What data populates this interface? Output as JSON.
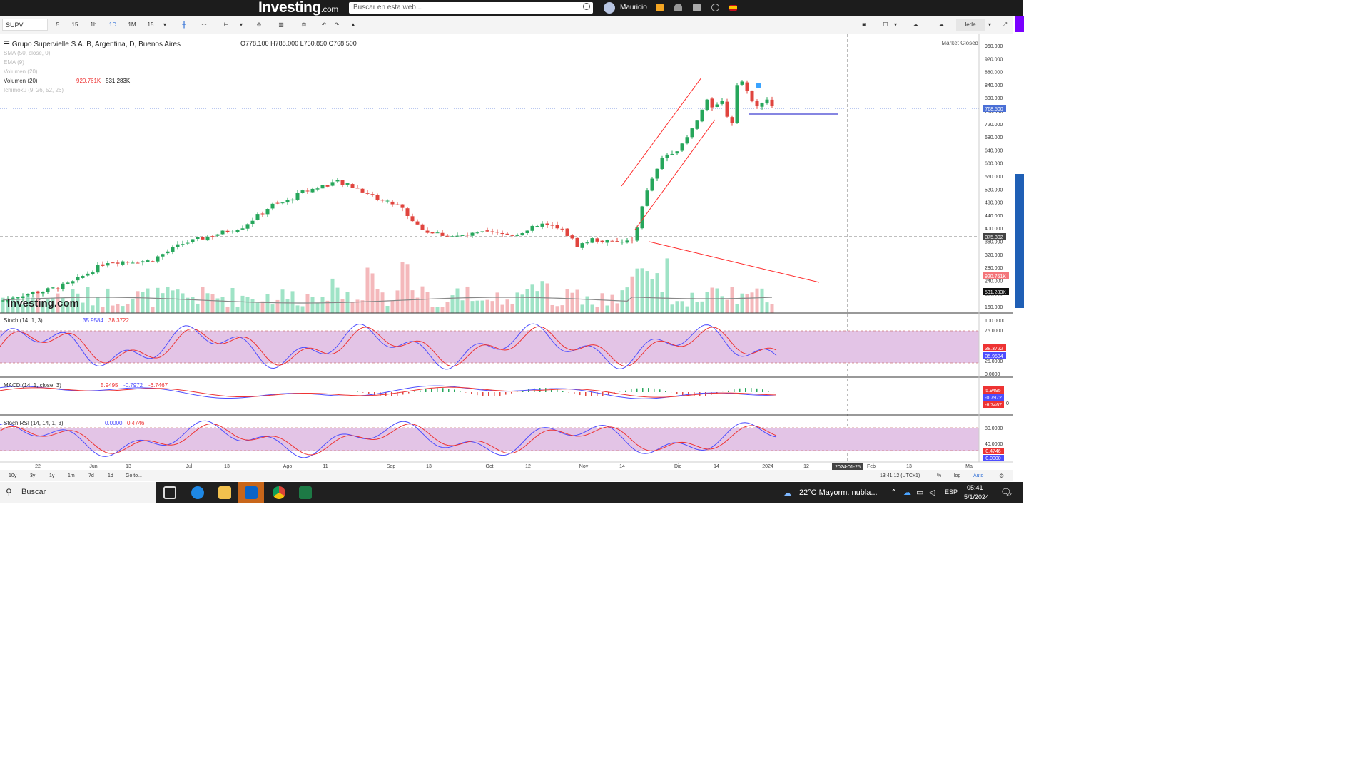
{
  "browser_topbar": {
    "logo_text": "Investing",
    "logo_suffix": ".com",
    "search_placeholder": "Buscar en esta web...",
    "user_name": "Mauricio"
  },
  "toolbar": {
    "symbol": "SUPV",
    "intervals": [
      "5",
      "15",
      "1h",
      "1D",
      "1M",
      "15"
    ],
    "selected_interval": "1D",
    "exchange_label": "lede"
  },
  "chart": {
    "title": "Grupo Supervielle S.A. B, Argentina, D, Buenos Aires",
    "ohlc": {
      "O": "778.100",
      "H": "788.000",
      "L": "750.850",
      "C": "768.500"
    },
    "status": "Market Closed",
    "indicators": [
      {
        "label": "SMA (50, close, 0)"
      },
      {
        "label": "EMA (9)"
      },
      {
        "label": "Volumen (20)"
      },
      {
        "label": "Volumen (20)",
        "v1": "920.761K",
        "v2": "531.283K"
      },
      {
        "label": "Ichimoku (9, 26, 52, 26)"
      }
    ],
    "watermark": "Investing.com",
    "price_ticks": [
      "960.000",
      "920.000",
      "880.000",
      "840.000",
      "800.000",
      "760.000",
      "720.000",
      "680.000",
      "640.000",
      "600.000",
      "560.000",
      "520.000",
      "480.000",
      "440.000",
      "400.000",
      "360.000",
      "320.000",
      "280.000",
      "240.000",
      "200.000",
      "160.000"
    ],
    "price_labels": {
      "last": "768.500",
      "hline": "375.302",
      "vol1": "920.761K",
      "vol2": "531.283K"
    },
    "panes": [
      {
        "label": "Stoch (14, 1, 3)",
        "v1": "35.9584",
        "v2": "38.3722",
        "ticks": [
          "100.0000",
          "75.0000",
          "50.0000",
          "25.0000",
          "0.0000"
        ],
        "badges": [
          "38.3722",
          "35.9584"
        ]
      },
      {
        "label": "MACD (14, 1, close, 3)",
        "v1": "5.9495",
        "v2": "-0.7972",
        "v3": "-6.7467",
        "ticks": [
          "0"
        ],
        "badges": [
          "5.9495",
          "-0.7972",
          "-6.7467"
        ]
      },
      {
        "label": "Stoch RSI (14, 14, 1, 3)",
        "v1": "0.0000",
        "v2": "0.4746",
        "ticks": [
          "80.0000",
          "40.0000"
        ],
        "badges": [
          "0.4746",
          "0.0000"
        ]
      }
    ],
    "x_labels": [
      "22",
      "Jun",
      "13",
      "Jul",
      "13",
      "Ago",
      "11",
      "Sep",
      "13",
      "Oct",
      "12",
      "Nov",
      "14",
      "Dic",
      "14",
      "2024",
      "12",
      "Feb",
      "13",
      "Ma"
    ],
    "crosshair_date": "2024-01-25",
    "ranges": [
      "10y",
      "3y",
      "1y",
      "1m",
      "7d",
      "1d",
      "Go to..."
    ],
    "footer_time": "13:41:12 (UTC+1)",
    "footer_opts": [
      "%",
      "log",
      "Auto"
    ]
  },
  "taskbar": {
    "search": "Buscar",
    "weather": "22°C  Mayorm. nubla...",
    "lang": "ESP",
    "time": "05:41",
    "date": "5/1/2024",
    "notif": "22"
  },
  "colors": {
    "up": "#26a65b",
    "down": "#e0443e",
    "vol_up": "#9fe3c6",
    "vol_down": "#f4b8bb",
    "band": "#e3c4e6"
  }
}
